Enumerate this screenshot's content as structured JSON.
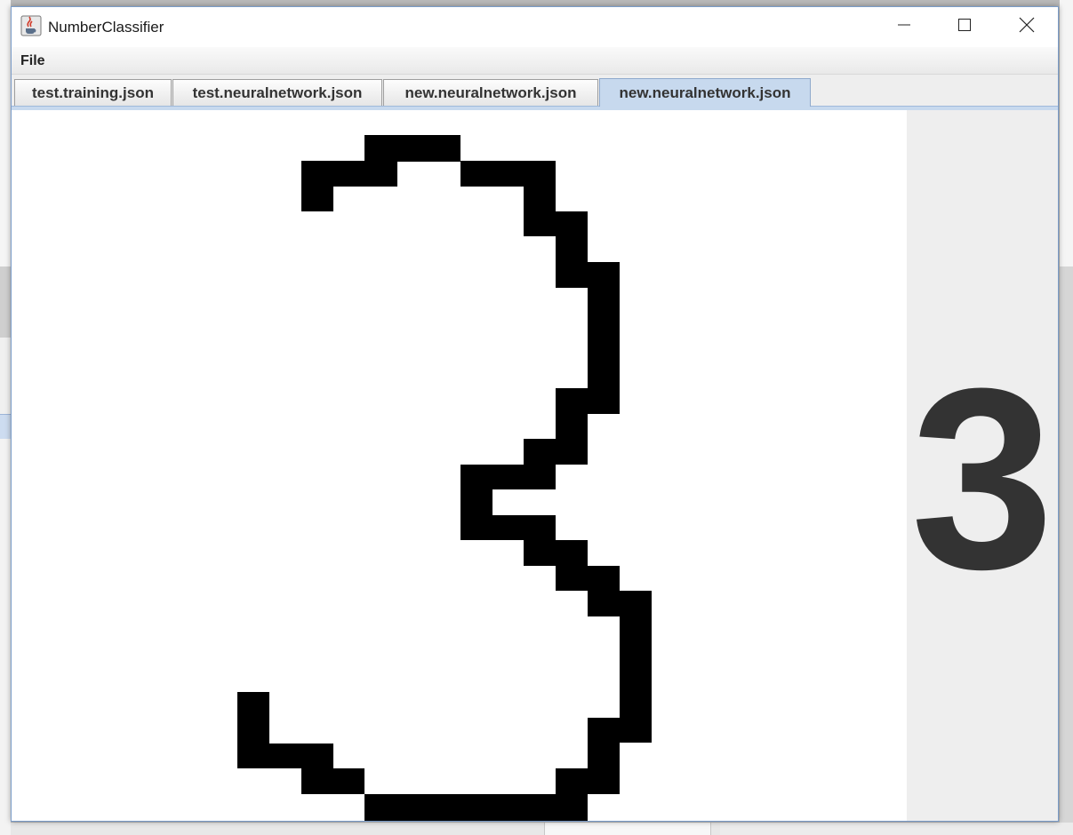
{
  "window": {
    "title": "NumberClassifier",
    "icon": "java-coffee-cup-icon"
  },
  "window_controls": {
    "minimize_icon": "minimize-icon",
    "maximize_icon": "maximize-icon",
    "close_icon": "close-icon"
  },
  "menu": {
    "file_label": "File"
  },
  "tabs": [
    {
      "label": "test.training.json",
      "active": false
    },
    {
      "label": "test.neuralnetwork.json",
      "active": false
    },
    {
      "label": "new.neuralnetwork.json",
      "active": false
    },
    {
      "label": "new.neuralnetwork.json",
      "active": true
    }
  ],
  "drawing": {
    "description_icon": "pixel-digit-drawing",
    "ink_color": "#000000",
    "background_color": "#ffffff"
  },
  "prediction": {
    "digit": "3",
    "color": "#333333"
  },
  "colors": {
    "active_tab": "#c7d9ee",
    "window_border": "#7a9cc9"
  }
}
